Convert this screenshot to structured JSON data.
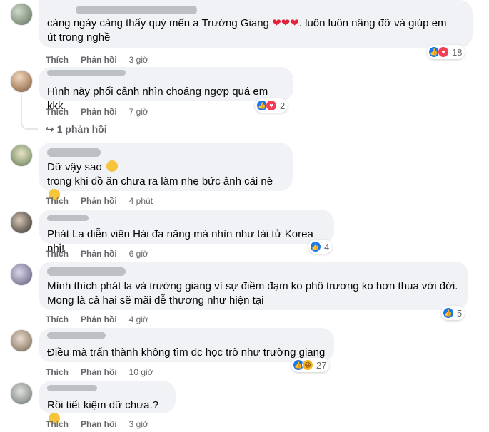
{
  "comments": [
    {
      "text": "càng ngày càng thấy quý mến a Trường Giang ❤️❤️❤️. luôn luôn nâng đỡ và giúp em út trong nghề",
      "line1": "càng ngày càng thấy quý mến a Trường Giang",
      "line1_tail": ". luôn luôn nâng đỡ và giúp em",
      "line2": "út trong nghề",
      "like_label": "Thích",
      "reply_label": "Phản hồi",
      "time": "3 giờ",
      "reaction_count": "18"
    },
    {
      "text": "Hình này phối cảnh nhìn choáng ngợp quá em kkk",
      "like_label": "Thích",
      "reply_label": "Phản hồi",
      "time": "7 giờ",
      "reaction_count": "2",
      "replies_link": "1 phản hồi"
    },
    {
      "line1": "Dữ vậy sao",
      "line2": "trong khi đồ ăn chưa ra làm nhẹ bức ảnh cái nè",
      "like_label": "Thích",
      "reply_label": "Phản hồi",
      "time": "4 phút"
    },
    {
      "text": "Phát La diễn viên Hài đa năng mà nhìn như tài tử Korea nhỉ!",
      "like_label": "Thích",
      "reply_label": "Phản hồi",
      "time": "6 giờ",
      "reaction_count": "4"
    },
    {
      "line1": "Mình thích phát la và trường giang vì sự điềm đạm ko phô trương ko hơn thua với đời.",
      "line2": "Mong là cả hai sẽ mãi dễ thương như hiện tại",
      "like_label": "Thích",
      "reply_label": "Phản hồi",
      "time": "4 giờ",
      "reaction_count": "5"
    },
    {
      "text": "Điều mà trấn thành không tìm dc học trò như trường giang",
      "like_label": "Thích",
      "reply_label": "Phản hồi",
      "time": "10 giờ",
      "reaction_count": "27"
    },
    {
      "text": "Rồi tiết kiệm dữ chưa.?",
      "like_label": "Thích",
      "reply_label": "Phản hồi",
      "time": "3 giờ"
    }
  ],
  "icons": {
    "like": "like-icon",
    "love": "love-icon",
    "haha": "haha-icon",
    "reply_arrow": "reply-arrow-icon"
  },
  "colors": {
    "bubble": "#f0f2f5",
    "meta": "#65676b",
    "like_blue": "#1877f2",
    "love_red": "#f33e58"
  }
}
